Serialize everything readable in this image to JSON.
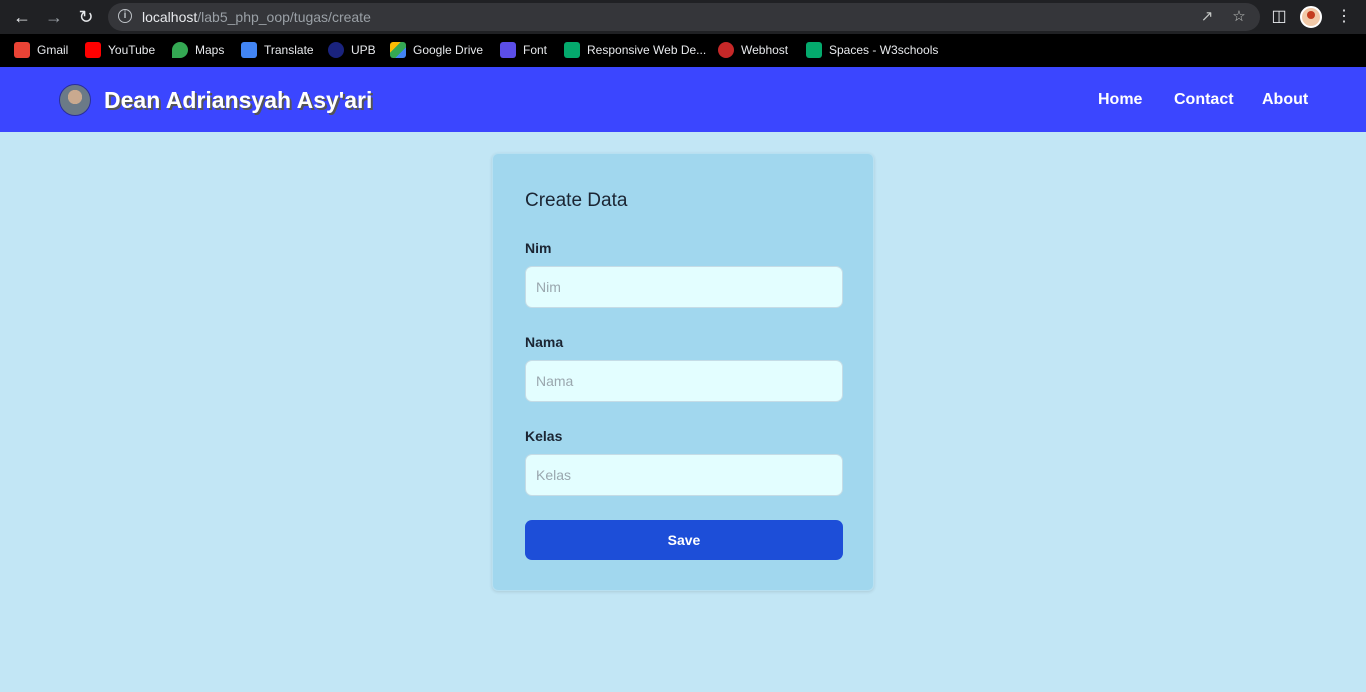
{
  "browser": {
    "url_host": "localhost",
    "url_path": "/lab5_php_oop/tugas/create",
    "bookmarks": [
      {
        "label": "Gmail",
        "icon": "gmail-icon",
        "color": "#ea4335"
      },
      {
        "label": "YouTube",
        "icon": "youtube-icon",
        "color": "#ff0000"
      },
      {
        "label": "Maps",
        "icon": "maps-icon",
        "color": "#34a853"
      },
      {
        "label": "Translate",
        "icon": "translate-icon",
        "color": "#4285f4"
      },
      {
        "label": "UPB",
        "icon": "upb-icon",
        "color": "#1a237e"
      },
      {
        "label": "Google Drive",
        "icon": "drive-icon",
        "color": "#fbbc04"
      },
      {
        "label": "Font",
        "icon": "font-icon",
        "color": "#5b4ee8"
      },
      {
        "label": "Responsive Web De...",
        "icon": "w3schools-icon",
        "color": "#04aa6d"
      },
      {
        "label": "Webhost",
        "icon": "webhost-icon",
        "color": "#c62828"
      },
      {
        "label": "Spaces - W3schools",
        "icon": "w3schools-icon",
        "color": "#04aa6d"
      }
    ]
  },
  "navbar": {
    "brand": "Dean Adriansyah Asy'ari",
    "links": [
      "Home",
      "Contact",
      "About"
    ],
    "color": "#3b46ff"
  },
  "form": {
    "title": "Create Data",
    "fields": [
      {
        "label": "Nim",
        "placeholder": "Nim",
        "value": ""
      },
      {
        "label": "Nama",
        "placeholder": "Nama",
        "value": ""
      },
      {
        "label": "Kelas",
        "placeholder": "Kelas",
        "value": ""
      }
    ],
    "submit_label": "Save",
    "button_color": "#1d4ed8"
  }
}
